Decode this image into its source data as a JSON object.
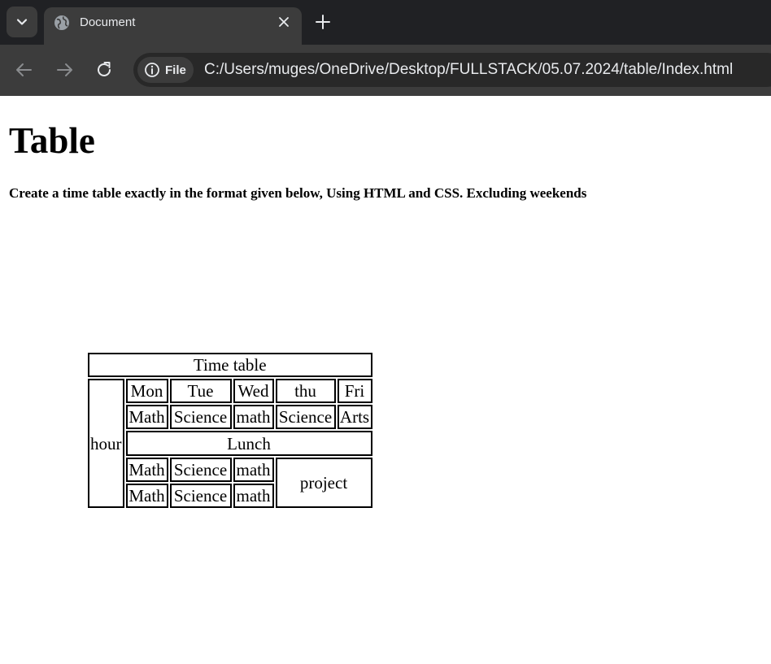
{
  "browser": {
    "tab_title": "Document",
    "file_chip_label": "File",
    "url": "C:/Users/muges/OneDrive/Desktop/FULLSTACK/05.07.2024/table/Index.html"
  },
  "page": {
    "heading": "Table",
    "instructions": "Create a time table exactly in the format given below, Using HTML and CSS. Excluding weekends"
  },
  "timetable": {
    "caption": "Time table",
    "row_header": "hour",
    "days": [
      "Mon",
      "Tue",
      "Wed",
      "thu",
      "Fri"
    ],
    "row1": [
      "Math",
      "Science",
      "math",
      "Science",
      "Arts"
    ],
    "lunch": "Lunch",
    "row3": [
      "Math",
      "Science",
      "math"
    ],
    "row4": [
      "Math",
      "Science",
      "math"
    ],
    "project": "project"
  }
}
